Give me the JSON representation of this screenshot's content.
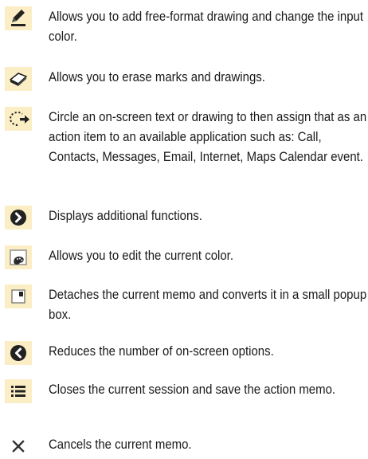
{
  "items": [
    {
      "icon": "pen-icon",
      "text": "Allows you to add free-format drawing and change the input color."
    },
    {
      "icon": "eraser-icon",
      "text": "Allows you to erase marks and drawings."
    },
    {
      "icon": "lasso-select-icon",
      "text": "Circle an on-screen text or drawing to then assign that as an action item to an available application such as: Call, Contacts, Messages, Email, Internet, Maps Calendar event."
    },
    {
      "icon": "chevron-right-circle-icon",
      "text": "Displays additional functions."
    },
    {
      "icon": "palette-icon",
      "text": "Allows you to edit the current color."
    },
    {
      "icon": "detach-window-icon",
      "text": "Detaches the current memo and converts it in a small popup box."
    },
    {
      "icon": "chevron-left-circle-icon",
      "text": "Reduces the number of on-screen options."
    },
    {
      "icon": "list-icon",
      "text": "Closes the current session and save the action memo."
    },
    {
      "icon": "close-icon",
      "text": "Cancels the current memo."
    }
  ]
}
